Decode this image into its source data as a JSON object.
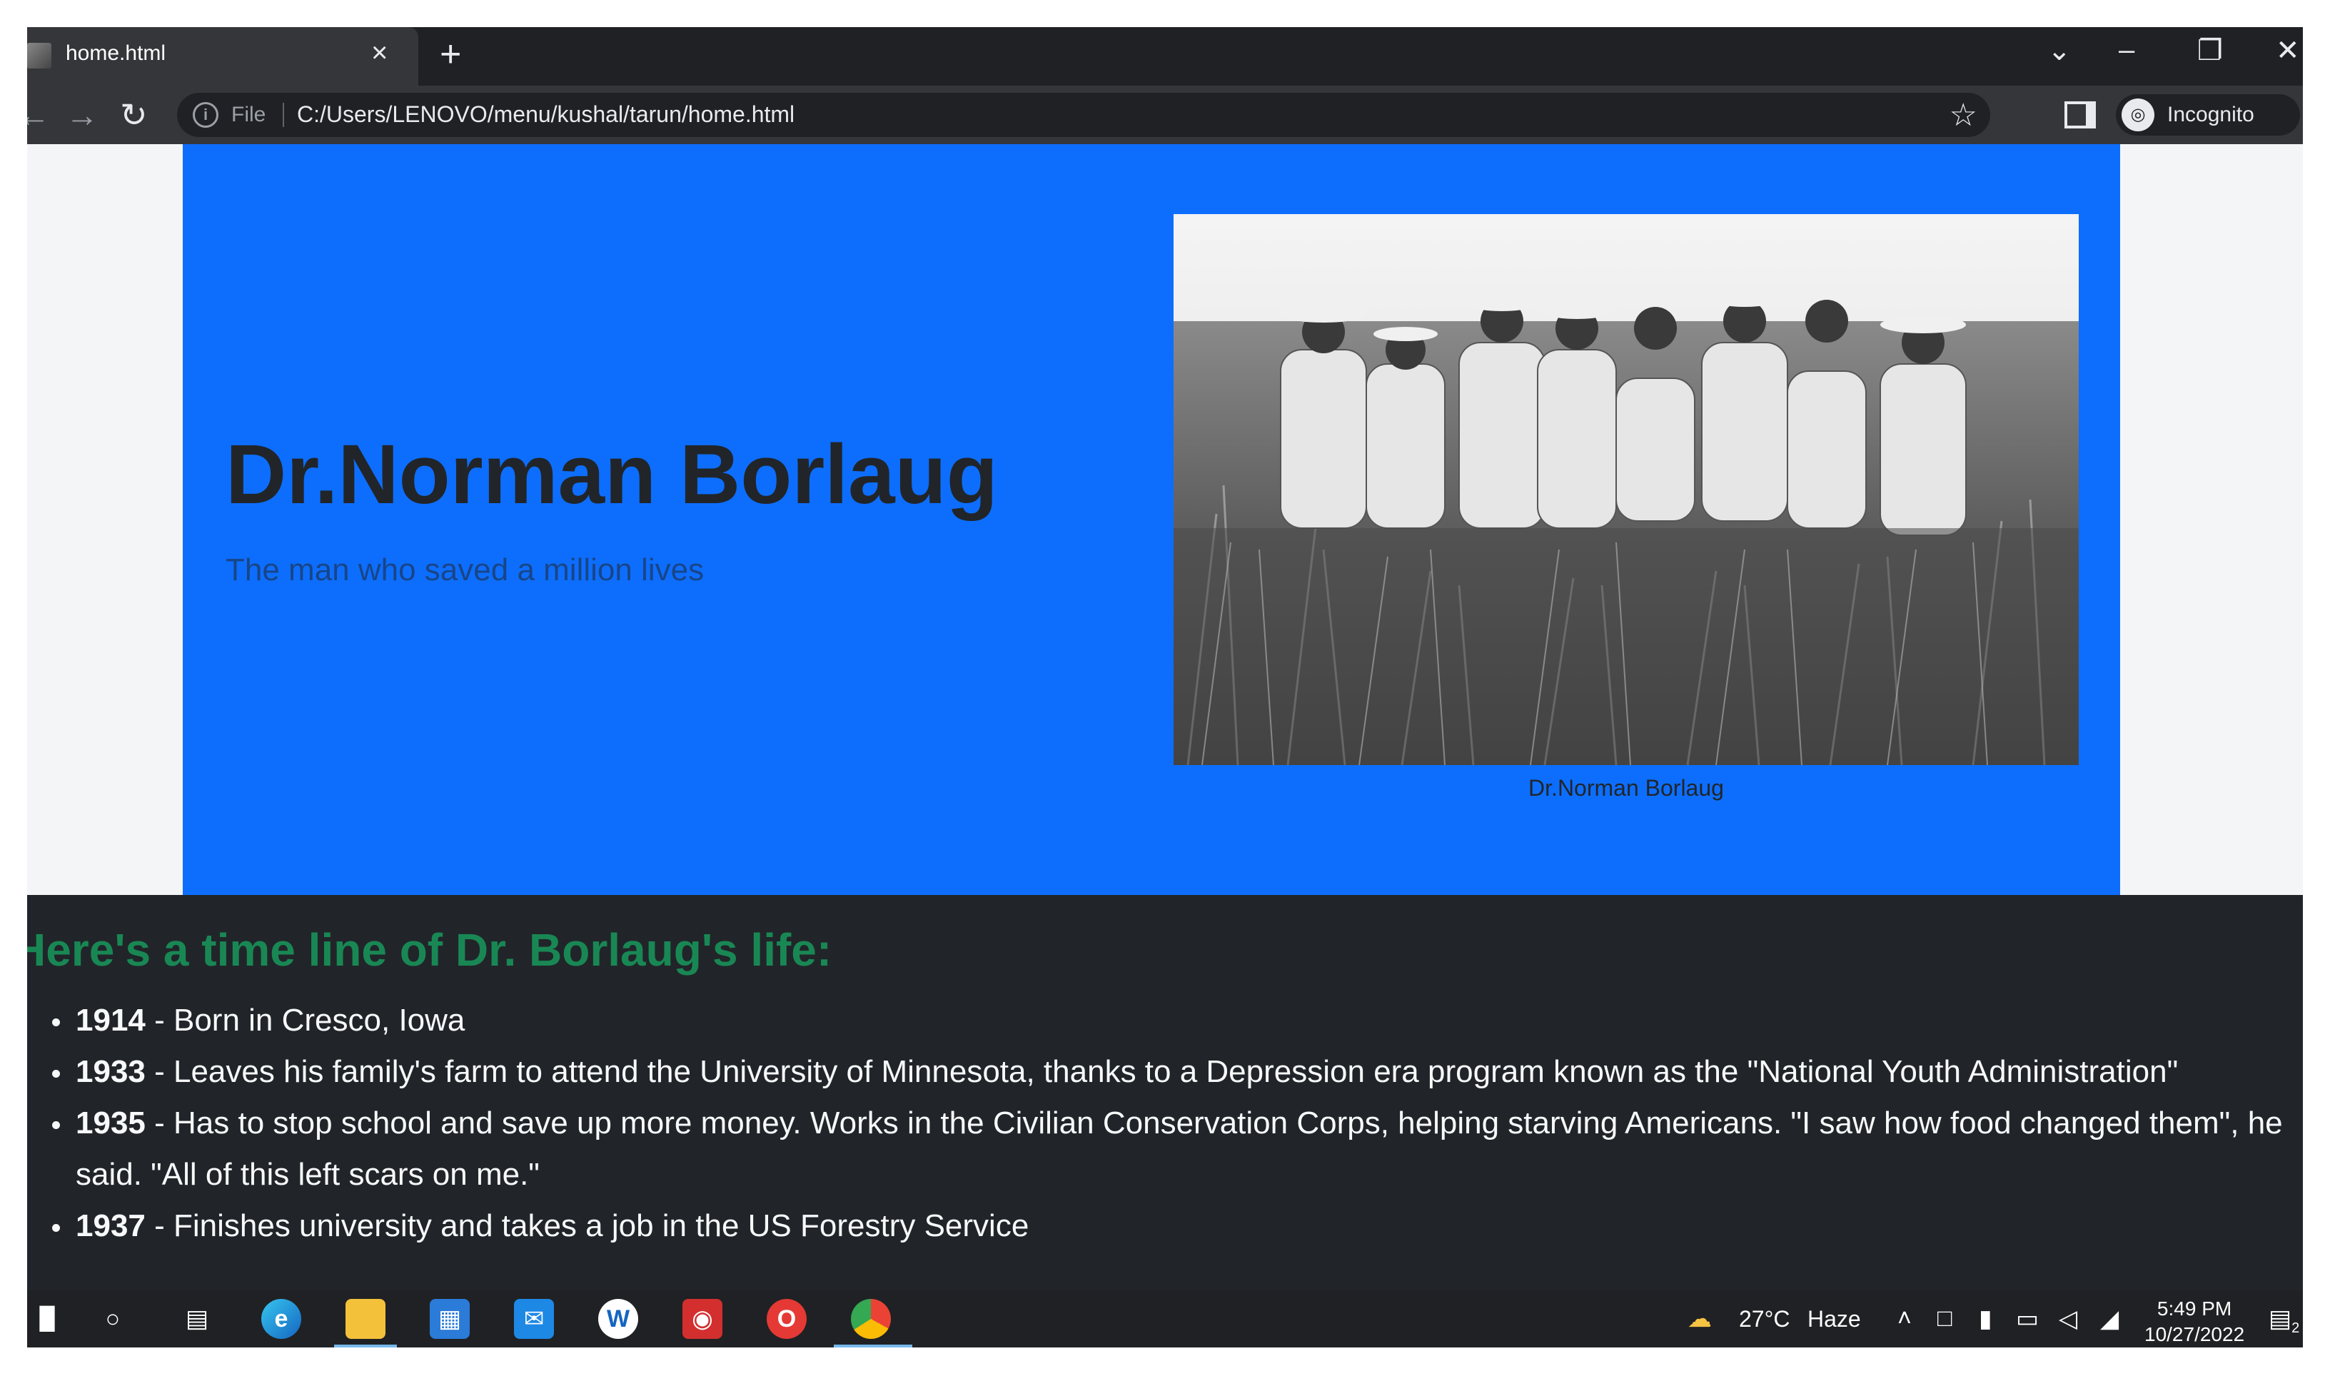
{
  "browser": {
    "tab_title": "home.html",
    "close_glyph": "×",
    "new_tab_glyph": "+",
    "file_label": "File",
    "url": "C:/Users/LENOVO/menu/kushal/tarun/home.html",
    "profile_label": "Incognito",
    "icons": [
      "back-arrow-icon",
      "forward-arrow-icon",
      "reload-icon",
      "info-icon",
      "bookmark-star-icon",
      "side-panel-icon",
      "incognito-icon",
      "chevron-down-icon",
      "minimize-icon",
      "restore-icon",
      "close-icon"
    ]
  },
  "hero": {
    "title": "Dr.Norman Borlaug",
    "subtitle": "The man who saved a million lives",
    "image_caption": "Dr.Norman Borlaug",
    "background": "#0d6efd"
  },
  "timeline": {
    "heading": "Here's a time line of Dr. Borlaug's life:",
    "heading_color": "#198754",
    "items": [
      {
        "year": "1914",
        "text": " - Born in Cresco, Iowa"
      },
      {
        "year": "1933",
        "text": " - Leaves his family's farm to attend the University of Minnesota, thanks to a Depression era program known as the \"National Youth Administration\""
      },
      {
        "year": "1935",
        "text": " - Has to stop school and save up more money. Works in the Civilian Conservation Corps, helping starving Americans. \"I saw how food changed them\", he said. \"All of this left scars on me.\""
      },
      {
        "year": "1937",
        "text": " - Finishes university and takes a job in the US Forestry Service"
      }
    ]
  },
  "taskbar": {
    "weather_temp": "27°C",
    "weather_desc": "Haze",
    "time": "5:49 PM",
    "date": "10/27/2022",
    "notification_count": "2",
    "apps": [
      "start-icon",
      "search-icon",
      "task-view-icon",
      "edge-icon",
      "file-explorer-icon",
      "store-icon",
      "mail-icon",
      "app-w-icon",
      "camera-app-icon",
      "opera-icon",
      "chrome-icon"
    ]
  }
}
